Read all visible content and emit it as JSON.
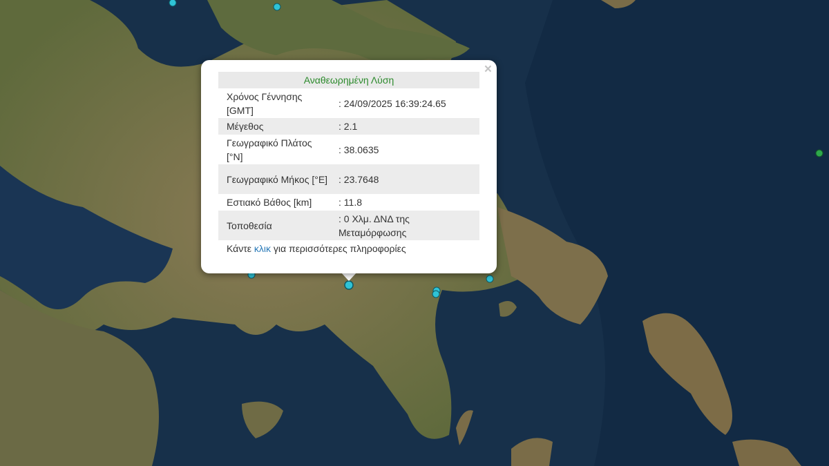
{
  "popup": {
    "title": "Αναθεωρημένη Λύση",
    "close_icon": "×",
    "rows": [
      {
        "label": "Χρόνος Γέννησης [GMT]",
        "value": ": 24/09/2025 16:39:24.65"
      },
      {
        "label": "Μέγεθος",
        "value": ": 2.1"
      },
      {
        "label": "Γεωγραφικό Πλάτος [°N]",
        "value": ": 38.0635"
      },
      {
        "label": "Γεωγραφικό Μήκος [°E]",
        "value": ": 23.7648"
      },
      {
        "label": "Εστιακό Βάθος [km]",
        "value": ": 11.8"
      },
      {
        "label": "Τοποθεσία",
        "value": ": 0 Χλμ. ΔΝΔ της Μεταμόρφωσης"
      }
    ],
    "footer": {
      "before": "Κάντε ",
      "link": "κλικ",
      "after": " για περισσότερες πληροφορίες"
    }
  },
  "colors": {
    "marker_cyan": "#2fc3d6",
    "marker_green": "#2ea84c",
    "title_green": "#2c8a2c",
    "link_blue": "#2a7ab8"
  }
}
